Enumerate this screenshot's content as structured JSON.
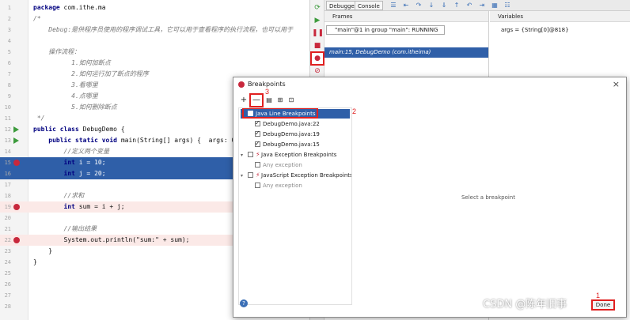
{
  "editor": {
    "lines": [
      {
        "n": "1",
        "text": "package com.ithe.ma",
        "kind": "normal"
      },
      {
        "n": "2",
        "text": "/*",
        "kind": "comment"
      },
      {
        "n": "3",
        "text": "    Debug:是供程序员使用的程序调试工具，它可以用于查看程序的执行流程，也可以用于",
        "kind": "comment"
      },
      {
        "n": "4",
        "text": "",
        "kind": "comment"
      },
      {
        "n": "5",
        "text": "    操作流程：",
        "kind": "comment"
      },
      {
        "n": "6",
        "text": "          1.如何加断点",
        "kind": "comment"
      },
      {
        "n": "7",
        "text": "          2.如何运行加了断点的程序",
        "kind": "comment"
      },
      {
        "n": "8",
        "text": "          3.看哪里",
        "kind": "comment"
      },
      {
        "n": "9",
        "text": "          4.点哪里",
        "kind": "comment"
      },
      {
        "n": "10",
        "text": "          5.如何删除断点",
        "kind": "comment"
      },
      {
        "n": "11",
        "text": " */",
        "kind": "comment"
      },
      {
        "n": "12",
        "text": "public class DebugDemo {",
        "kind": "normal",
        "marker": "run"
      },
      {
        "n": "13",
        "text": "    public static void main(String[] args) {  args: 0",
        "kind": "normal",
        "marker": "run"
      },
      {
        "n": "14",
        "text": "        //定义两个变量",
        "kind": "comment"
      },
      {
        "n": "15",
        "text": "        int i = 10;",
        "kind": "exec",
        "marker": "bp"
      },
      {
        "n": "16",
        "text": "        int j = 20;",
        "kind": "exec"
      },
      {
        "n": "17",
        "text": "",
        "kind": "normal"
      },
      {
        "n": "18",
        "text": "        //求和",
        "kind": "comment"
      },
      {
        "n": "19",
        "text": "        int sum = i + j;",
        "kind": "bp",
        "marker": "bp"
      },
      {
        "n": "20",
        "text": "",
        "kind": "normal"
      },
      {
        "n": "21",
        "text": "        //输出结果",
        "kind": "comment"
      },
      {
        "n": "22",
        "text": "        System.out.println(\"sum:\" + sum);",
        "kind": "bp",
        "marker": "bp"
      },
      {
        "n": "23",
        "text": "    }",
        "kind": "normal"
      },
      {
        "n": "24",
        "text": "}",
        "kind": "normal"
      },
      {
        "n": "25",
        "text": "",
        "kind": "normal"
      },
      {
        "n": "26",
        "text": "",
        "kind": "normal"
      },
      {
        "n": "27",
        "text": "",
        "kind": "normal"
      },
      {
        "n": "28",
        "text": "",
        "kind": "normal"
      }
    ]
  },
  "debug": {
    "tab_debugger": "Debugger",
    "tab_console": "Console",
    "frames_label": "Frames",
    "variables_label": "Variables",
    "thread": "\"main\"@1 in group \"main\": RUNNING",
    "frame": "main:15, DebugDemo (com.itheima)",
    "var_args": "args = {String[0]@818}"
  },
  "dialog": {
    "title": "Breakpoints",
    "close": "×",
    "add": "+",
    "remove": "—",
    "tree": [
      {
        "label": "Java Line Breakpoints",
        "level": 0,
        "checked": true,
        "selected": true,
        "type": "group"
      },
      {
        "label": "DebugDemo.java:22",
        "level": 1,
        "checked": true,
        "selected": false,
        "type": "item"
      },
      {
        "label": "DebugDemo.java:19",
        "level": 1,
        "checked": true,
        "selected": false,
        "type": "item"
      },
      {
        "label": "DebugDemo.java:15",
        "level": 1,
        "checked": true,
        "selected": false,
        "type": "item"
      },
      {
        "label": "Java Exception Breakpoints",
        "level": 0,
        "checked": false,
        "selected": false,
        "type": "exgroup"
      },
      {
        "label": "Any exception",
        "level": 1,
        "checked": false,
        "selected": false,
        "type": "muted"
      },
      {
        "label": "JavaScript Exception Breakpoints",
        "level": 0,
        "checked": false,
        "selected": false,
        "type": "exgroup"
      },
      {
        "label": "Any exception",
        "level": 1,
        "checked": false,
        "selected": false,
        "type": "muted"
      }
    ],
    "select_hint": "Select a breakpoint",
    "done": "Done",
    "annotations": {
      "a1": "1",
      "a2": "2",
      "a3": "3"
    }
  },
  "watermark": "CSDN @陈年旧事"
}
